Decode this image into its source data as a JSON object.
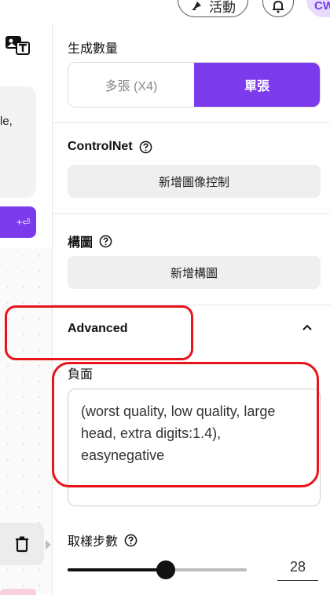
{
  "header": {
    "events_label": "活動",
    "avatar_initials": "CW"
  },
  "left": {
    "card_text": "le,",
    "button_glyph": "+⏎"
  },
  "generate_count": {
    "label": "生成數量",
    "options": [
      "多張 (X4)",
      "單張"
    ],
    "selected": "單張"
  },
  "controlnet": {
    "label": "ControlNet",
    "button": "新增圖像控制"
  },
  "composition": {
    "label": "構圖",
    "button": "新增構圖"
  },
  "advanced": {
    "label": "Advanced",
    "expanded": true
  },
  "negative": {
    "label": "負面",
    "value": "(worst quality, low quality, large head, extra digits:1.4), easynegative"
  },
  "steps": {
    "label": "取樣步數",
    "value": "28",
    "slider_fraction": 0.55
  },
  "colors": {
    "accent": "#7c3aed",
    "annotation": "#e8141c"
  }
}
